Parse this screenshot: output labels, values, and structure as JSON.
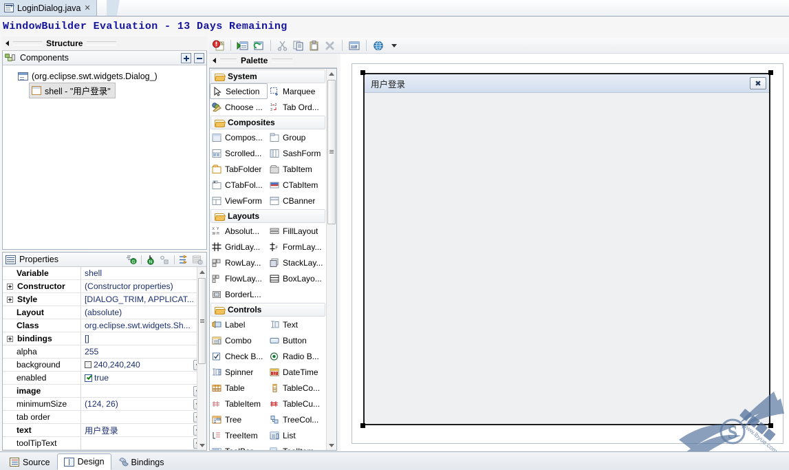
{
  "editor_tab": {
    "title": "LoginDialog.java",
    "close": "✕",
    "icon": "java-file-icon"
  },
  "eval_banner": {
    "text": "WindowBuilder Evaluation - 13 Days Remaining",
    "color": "#15149c"
  },
  "structure": {
    "tab_label": "Structure",
    "header_label": "Components",
    "expand_all_tooltip": "Expand All",
    "collapse_all_tooltip": "Collapse All",
    "tree": [
      {
        "label": "(org.eclipse.swt.widgets.Dialog_)",
        "icon": "dialog-icon",
        "selected": false
      },
      {
        "label": "shell - \"用户登录\"",
        "icon": "shell-icon",
        "selected": true
      }
    ]
  },
  "properties": {
    "title": "Properties",
    "rows": [
      {
        "name": "Variable",
        "value": "shell",
        "bold": true,
        "expander": false,
        "dots": false,
        "widget": ""
      },
      {
        "name": "Constructor",
        "value": "(Constructor properties)",
        "bold": true,
        "expander": true,
        "dots": false,
        "widget": ""
      },
      {
        "name": "Style",
        "value": "[DIALOG_TRIM, APPLICAT...",
        "bold": true,
        "expander": true,
        "dots": false,
        "widget": ""
      },
      {
        "name": "Layout",
        "value": "(absolute)",
        "bold": true,
        "expander": false,
        "dots": false,
        "widget": ""
      },
      {
        "name": "Class",
        "value": "org.eclipse.swt.widgets.Sh...",
        "bold": true,
        "expander": false,
        "dots": false,
        "widget": ""
      },
      {
        "name": "bindings",
        "value": "[]",
        "bold": true,
        "expander": true,
        "dots": false,
        "widget": ""
      },
      {
        "name": "alpha",
        "value": "255",
        "bold": false,
        "expander": false,
        "dots": false,
        "widget": ""
      },
      {
        "name": "background",
        "value": "240,240,240",
        "bold": false,
        "expander": false,
        "dots": true,
        "widget": "color"
      },
      {
        "name": "enabled",
        "value": "true",
        "bold": false,
        "expander": false,
        "dots": false,
        "widget": "checkbox"
      },
      {
        "name": "image",
        "value": "",
        "bold": true,
        "expander": false,
        "dots": true,
        "widget": ""
      },
      {
        "name": "minimumSize",
        "value": "(124, 26)",
        "bold": false,
        "expander": false,
        "dots": true,
        "widget": ""
      },
      {
        "name": "tab order",
        "value": "",
        "bold": false,
        "expander": false,
        "dots": true,
        "widget": ""
      },
      {
        "name": "text",
        "value": "用户登录",
        "bold": true,
        "expander": false,
        "dots": true,
        "widget": ""
      },
      {
        "name": "toolTipText",
        "value": "",
        "bold": false,
        "expander": false,
        "dots": true,
        "widget": ""
      }
    ]
  },
  "toolbar": {
    "buttons": [
      {
        "name": "test-error-icon"
      },
      {
        "name": "open-editor-icon"
      },
      {
        "name": "refresh-icon"
      },
      {
        "name": "cut-icon"
      },
      {
        "name": "copy-icon"
      },
      {
        "name": "paste-icon"
      },
      {
        "name": "delete-icon"
      },
      {
        "name": "test-window-icon"
      },
      {
        "name": "external-browse-icon"
      }
    ]
  },
  "palette": {
    "tab_label": "Palette",
    "categories": [
      {
        "name": "System",
        "items": [
          {
            "label": "Selection",
            "icon": "cursor-icon",
            "selected": true
          },
          {
            "label": "Marquee",
            "icon": "marquee-icon",
            "selected": false
          },
          {
            "label": "Choose ...",
            "icon": "choose-icon",
            "selected": false
          },
          {
            "label": "Tab Ord...",
            "icon": "taborder-icon",
            "selected": false
          }
        ]
      },
      {
        "name": "Composites",
        "items": [
          {
            "label": "Compos...",
            "icon": "composite-icon",
            "selected": false
          },
          {
            "label": "Group",
            "icon": "group-icon",
            "selected": false
          },
          {
            "label": "Scrolled...",
            "icon": "scrolled-icon",
            "selected": false
          },
          {
            "label": "SashForm",
            "icon": "sashform-icon",
            "selected": false
          },
          {
            "label": "TabFolder",
            "icon": "tabfolder-icon",
            "selected": false
          },
          {
            "label": "TabItem",
            "icon": "tabitem-icon",
            "selected": false
          },
          {
            "label": "CTabFol...",
            "icon": "ctabfolder-icon",
            "selected": false
          },
          {
            "label": "CTabItem",
            "icon": "ctabitem-icon",
            "selected": false
          },
          {
            "label": "ViewForm",
            "icon": "viewform-icon",
            "selected": false
          },
          {
            "label": "CBanner",
            "icon": "cbanner-icon",
            "selected": false
          }
        ]
      },
      {
        "name": "Layouts",
        "items": [
          {
            "label": "Absolut...",
            "icon": "absolute-layout-icon",
            "selected": false
          },
          {
            "label": "FillLayout",
            "icon": "fill-layout-icon",
            "selected": false
          },
          {
            "label": "GridLay...",
            "icon": "grid-layout-icon",
            "selected": false
          },
          {
            "label": "FormLay...",
            "icon": "form-layout-icon",
            "selected": false
          },
          {
            "label": "RowLay...",
            "icon": "row-layout-icon",
            "selected": false
          },
          {
            "label": "StackLay...",
            "icon": "stack-layout-icon",
            "selected": false
          },
          {
            "label": "FlowLay...",
            "icon": "flow-layout-icon",
            "selected": false
          },
          {
            "label": "BoxLayo...",
            "icon": "box-layout-icon",
            "selected": false
          },
          {
            "label": "BorderL...",
            "icon": "border-layout-icon",
            "selected": false
          }
        ]
      },
      {
        "name": "Controls",
        "items": [
          {
            "label": "Label",
            "icon": "label-icon",
            "selected": false
          },
          {
            "label": "Text",
            "icon": "text-icon",
            "selected": false
          },
          {
            "label": "Combo",
            "icon": "combo-icon",
            "selected": false
          },
          {
            "label": "Button",
            "icon": "button-icon",
            "selected": false
          },
          {
            "label": "Check B...",
            "icon": "checkbox-icon",
            "selected": false
          },
          {
            "label": "Radio B...",
            "icon": "radio-icon",
            "selected": false
          },
          {
            "label": "Spinner",
            "icon": "spinner-icon",
            "selected": false
          },
          {
            "label": "DateTime",
            "icon": "datetime-icon",
            "selected": false
          },
          {
            "label": "Table",
            "icon": "table-icon",
            "selected": false
          },
          {
            "label": "TableCo...",
            "icon": "tablecolumn-icon",
            "selected": false
          },
          {
            "label": "TableItem",
            "icon": "tableitem-icon",
            "selected": false
          },
          {
            "label": "TableCu...",
            "icon": "tablecursor-icon",
            "selected": false
          },
          {
            "label": "Tree",
            "icon": "tree-icon",
            "selected": false
          },
          {
            "label": "TreeCol...",
            "icon": "treecolumn-icon",
            "selected": false
          },
          {
            "label": "TreeItem",
            "icon": "treeitem-icon",
            "selected": false
          },
          {
            "label": "List",
            "icon": "list-icon",
            "selected": false
          },
          {
            "label": "ToolBar",
            "icon": "toolbar-icon",
            "selected": false
          },
          {
            "label": "ToolItem",
            "icon": "toolitem-icon",
            "selected": false
          }
        ]
      }
    ]
  },
  "design": {
    "shell_title": "用户登录",
    "close_glyph": "✖"
  },
  "bottom_tabs": [
    {
      "label": "Source",
      "icon": "source-icon",
      "active": false
    },
    {
      "label": "Design",
      "icon": "design-icon",
      "active": true
    },
    {
      "label": "Bindings",
      "icon": "bindings-icon",
      "active": false
    }
  ],
  "watermark": {
    "text": "www.lbyue.com",
    "mark": "S"
  }
}
